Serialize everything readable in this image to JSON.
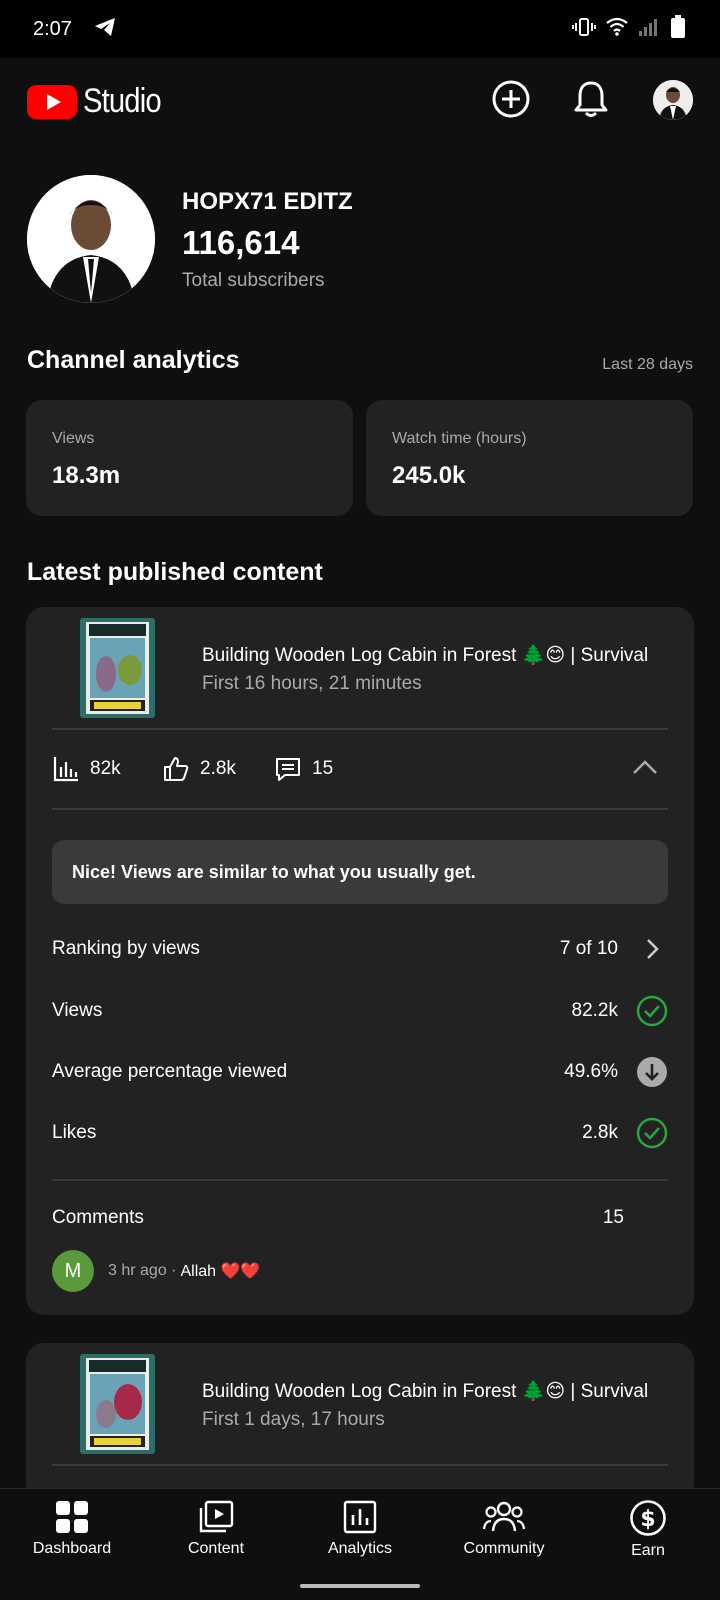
{
  "status_bar": {
    "time": "2:07"
  },
  "header": {
    "logo_text": "Studio"
  },
  "channel": {
    "name": "HOPX71 EDITZ",
    "subscribers": "116,614",
    "subscribers_label": "Total subscribers"
  },
  "analytics": {
    "title": "Channel analytics",
    "range": "Last 28 days",
    "cards": [
      {
        "label": "Views",
        "value": "18.3m"
      },
      {
        "label": "Watch time (hours)",
        "value": "245.0k"
      }
    ]
  },
  "latest": {
    "title": "Latest published content",
    "items": [
      {
        "title": "Building Wooden Log Cabin in Forest 🌲😊 | Survival",
        "subtitle": "First 16 hours, 21 minutes",
        "views": "82k",
        "likes": "2.8k",
        "comments": "15",
        "insight": "Nice! Views are similar to what you usually get.",
        "rows": [
          {
            "label": "Ranking by views",
            "value": "7 of 10",
            "icon": "chevron-right-icon"
          },
          {
            "label": "Views",
            "value": "82.2k",
            "icon": "check-circle-icon"
          },
          {
            "label": "Average percentage viewed",
            "value": "49.6%",
            "icon": "arrow-down-circle-icon"
          },
          {
            "label": "Likes",
            "value": "2.8k",
            "icon": "check-circle-icon"
          }
        ],
        "comments_label": "Comments",
        "comments_value": "15",
        "latest_comment": {
          "avatar_letter": "M",
          "meta": "3 hr ago · ",
          "text": "Allah ❤️❤️"
        }
      },
      {
        "title": "Building Wooden Log Cabin in Forest 🌲😊 | Survival",
        "subtitle": "First 1 days, 17 hours"
      }
    ]
  },
  "nav": {
    "items": [
      {
        "label": "Dashboard"
      },
      {
        "label": "Content"
      },
      {
        "label": "Analytics"
      },
      {
        "label": "Community"
      },
      {
        "label": "Earn"
      }
    ]
  },
  "colors": {
    "background": "#0f0f0f",
    "card": "#222222",
    "brand_red": "#ff0000",
    "success_green": "#2ba640"
  }
}
